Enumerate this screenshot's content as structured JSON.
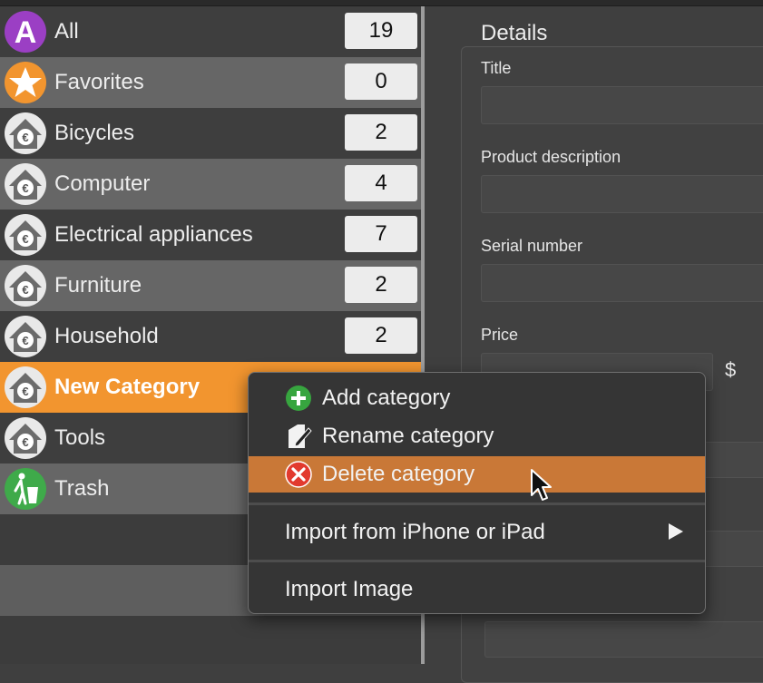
{
  "sidebar": {
    "items": [
      {
        "label": "All",
        "count": "19",
        "icon": "letter-a-icon"
      },
      {
        "label": "Favorites",
        "count": "0",
        "icon": "star-icon"
      },
      {
        "label": "Bicycles",
        "count": "2",
        "icon": "euro-house-icon"
      },
      {
        "label": "Computer",
        "count": "4",
        "icon": "euro-house-icon"
      },
      {
        "label": "Electrical appliances",
        "count": "7",
        "icon": "euro-house-icon"
      },
      {
        "label": "Furniture",
        "count": "2",
        "icon": "euro-house-icon"
      },
      {
        "label": "Household",
        "count": "2",
        "icon": "euro-house-icon"
      },
      {
        "label": "New Category",
        "count": "",
        "icon": "euro-house-icon"
      },
      {
        "label": "Tools",
        "count": "",
        "icon": "euro-house-icon"
      },
      {
        "label": "Trash",
        "count": "",
        "icon": "trash-icon"
      }
    ],
    "all_icon_letter": "A"
  },
  "details": {
    "title": "Details",
    "fields": {
      "title_label": "Title",
      "description_label": "Product description",
      "serial_label": "Serial number",
      "price_label": "Price",
      "currency": "$"
    }
  },
  "context_menu": {
    "items": [
      {
        "label": "Add category",
        "icon": "plus-circle-icon"
      },
      {
        "label": "Rename category",
        "icon": "rename-pencil-icon"
      },
      {
        "label": "Delete category",
        "icon": "delete-x-icon",
        "highlighted": true
      },
      {
        "label": "Import from iPhone or iPad",
        "submenu": true
      },
      {
        "label": "Import Image"
      }
    ]
  },
  "colors": {
    "selected_row": "#f2952f",
    "menu_highlight": "#c97837",
    "all_icon": "#9b3fc4",
    "favorites_icon": "#f2952f",
    "trash_icon": "#3faa4a"
  }
}
